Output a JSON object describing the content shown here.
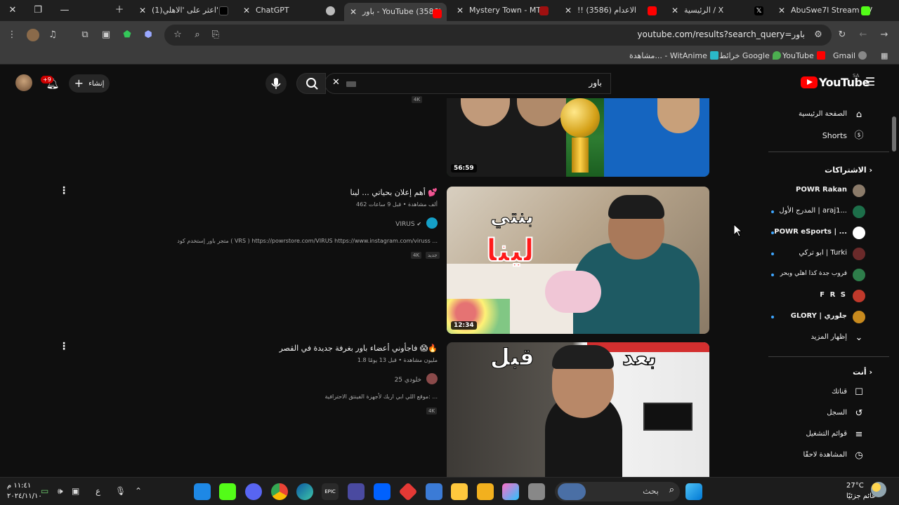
{
  "browser": {
    "tabs": [
      {
        "title": "(1)اعثر على 'الاهلي' ...",
        "active": false
      },
      {
        "title": "ChatGPT",
        "active": false
      },
      {
        "title": "باور - YouTube (3586)",
        "active": true
      },
      {
        "title": "Mystery Town - MT S",
        "active": false
      },
      {
        "title": "!! الاعدام (3586)",
        "active": false
      },
      {
        "title": "الرئيسية / X",
        "active": false
      },
      {
        "title": "AbuSwe7l Stream - V",
        "active": false
      }
    ],
    "url": "youtube.com/results?search_query=باور",
    "bookmarks": [
      "Gmail",
      "YouTube",
      "خرائط Google",
      "مشاهدة... - WitAnime"
    ]
  },
  "youtube": {
    "logo_text": "YouTube",
    "country_code": "SA",
    "search_query": "باور",
    "create_label": "إنشاء",
    "notification_count": "+9"
  },
  "sidebar": {
    "main": [
      {
        "label": "الصفحة الرئيسية",
        "icon": "home-icon"
      },
      {
        "label": "Shorts",
        "icon": "shorts-icon"
      }
    ],
    "subscriptions_title": "الاشتراكات",
    "subscriptions": [
      {
        "label": "POWR Rakan",
        "dot": false
      },
      {
        "label": "المدرج الأول | araj1...",
        "dot": true
      },
      {
        "label": "POWR eSports | ...",
        "dot": true
      },
      {
        "label": "ابو تركي | Turki",
        "dot": true
      },
      {
        "label": "قروب جدة كذا اهلي وبحر",
        "dot": true
      },
      {
        "label": "F R S",
        "dot": false
      },
      {
        "label": "GLORY | جلوري",
        "dot": true
      }
    ],
    "show_more": "إظهار المزيد",
    "you_title": "أنت",
    "you_items": [
      {
        "label": "قناتك",
        "icon": "channel-icon"
      },
      {
        "label": "السجل",
        "icon": "history-icon"
      },
      {
        "label": "قوائم التشغيل",
        "icon": "playlists-icon"
      },
      {
        "label": "المشاهدة لاحقًا",
        "icon": "watch-later-icon"
      }
    ]
  },
  "results": [
    {
      "duration": "56:59",
      "badge": "4K",
      "title": "",
      "meta": "",
      "channel": "",
      "desc": ""
    },
    {
      "duration": "12:34",
      "title": "أهم إعلان بحياتي ... لينا 💕",
      "meta": "462 ألف مشاهدة • قبل 9 ساعات",
      "channel": "VIRUS",
      "desc": "متجر باور إستخدم كود ( VRS ) https://powrstore.com/VIRUS https://www.instagram.com/viruss ...",
      "badges": [
        "جديد",
        "4K"
      ],
      "thumb_text": [
        "بنتي",
        "لينا"
      ]
    },
    {
      "duration": "",
      "title": "فاجأوني أعضاء باور بغرفة جديدة في القصر 😱🔥",
      "meta": "1.8 مليون مشاهدة • قبل 13 يومًا",
      "channel": "خلودي 25",
      "desc": "موقع اللي ابي اربك لأجهزة الفينتق الاحترافية: ...",
      "badges": [
        "4K"
      ],
      "thumb_text": [
        "بعد",
        "قبل"
      ]
    }
  ],
  "taskbar": {
    "search_placeholder": "بحث",
    "time": "١١:٤١ م",
    "date": "٢٠٢٤/١١/١٠",
    "weather_temp": "27°C",
    "weather_desc": "غائم جزئيًا",
    "lang": "ع"
  },
  "colors": {
    "background": "#0f0f0f",
    "youtube_red": "#ff0000",
    "tab_active": "#3c3c3c",
    "link_blue": "#3ea6ff"
  }
}
